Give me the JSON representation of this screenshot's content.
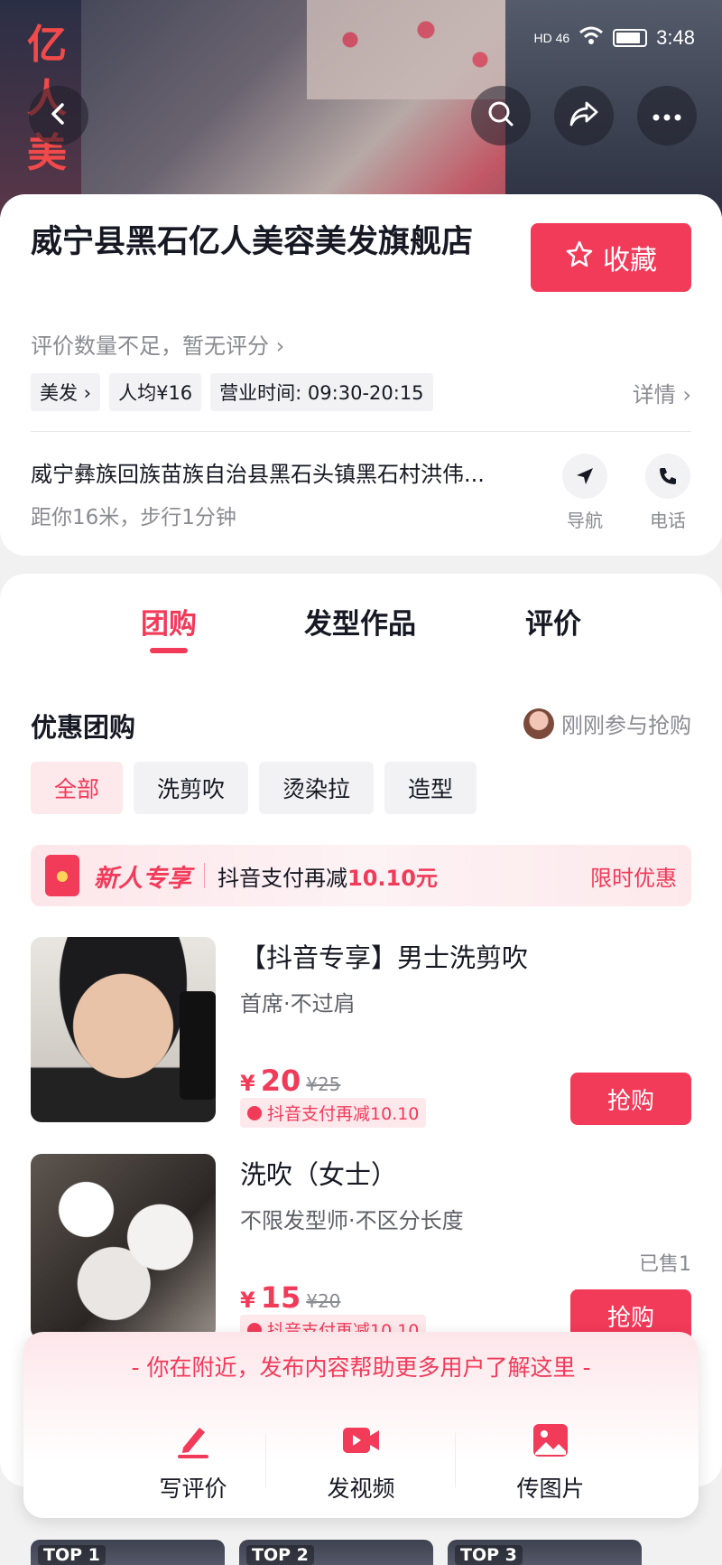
{
  "status": {
    "network": "HD 46",
    "time": "3:48"
  },
  "hero": {
    "sign_text": "亿人美"
  },
  "shop": {
    "name": "威宁县黑石亿人美容美发旗舰店",
    "favorite_label": "收藏",
    "rating_text": "评价数量不足，暂无评分",
    "tags": [
      "美发",
      "人均¥16",
      "营业时间: 09:30-20:15"
    ],
    "detail_label": "详情",
    "address": "威宁彝族回族苗族自治县黑石头镇黑石村洪伟...",
    "distance": "距你16米，步行1分钟",
    "nav_label": "导航",
    "phone_label": "电话"
  },
  "tabs": [
    "团购",
    "发型作品",
    "评价"
  ],
  "section": {
    "title": "优惠团购",
    "recent": "刚刚参与抢购"
  },
  "filters": [
    "全部",
    "洗剪吹",
    "烫染拉",
    "造型"
  ],
  "promo": {
    "badge": "新人专享",
    "text": "抖音支付再减",
    "amount": "10.10元",
    "limit": "限时优惠"
  },
  "deals": [
    {
      "title": "【抖音专享】男士洗剪吹",
      "sub": "首席·不过肩",
      "sold": "",
      "currency": "¥",
      "price": "20",
      "old_price": "¥25",
      "coupon": "抖音支付再减10.10",
      "buy": "抢购"
    },
    {
      "title": "洗吹（女士）",
      "sub": "不限发型师·不区分长度",
      "sold": "已售1",
      "currency": "¥",
      "price": "15",
      "old_price": "¥20",
      "coupon": "抖音支付再减10.10",
      "buy": "抢购"
    }
  ],
  "panel": {
    "hint": "- 你在附近，发布内容帮助更多用户了解这里 -",
    "options": [
      "写评价",
      "发视频",
      "传图片"
    ]
  },
  "top_cards": [
    "TOP 1",
    "TOP 2",
    "TOP 3"
  ],
  "colors": {
    "accent": "#f23a59",
    "text": "#161823",
    "muted": "#8a8b91"
  }
}
